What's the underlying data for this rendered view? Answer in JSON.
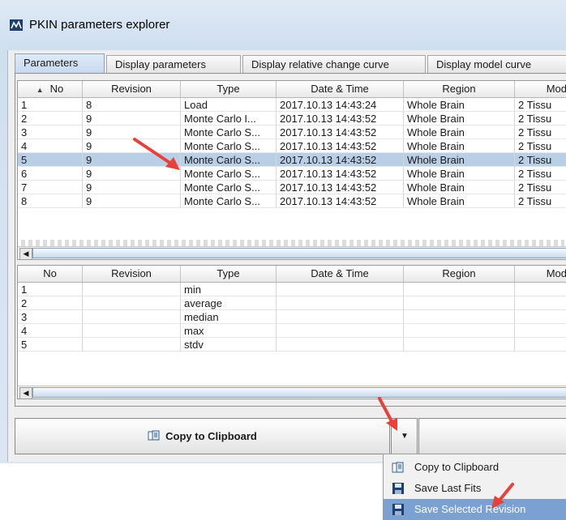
{
  "window": {
    "title": "PKIN parameters explorer"
  },
  "tabs": [
    {
      "label": "Parameters",
      "active": true
    },
    {
      "label": "Display parameters",
      "active": false
    },
    {
      "label": "Display relative change curve",
      "active": false
    },
    {
      "label": "Display model curve",
      "active": false
    }
  ],
  "top_table": {
    "sort_icon": "sort-ascending-triangle",
    "columns": [
      "No",
      "Revision",
      "Type",
      "Date & Time",
      "Region",
      "Mod"
    ],
    "rows": [
      {
        "no": "1",
        "revision": "8",
        "type": "Load",
        "datetime": "2017.10.13 14:43:24",
        "region": "Whole Brain",
        "model": "2 Tissu"
      },
      {
        "no": "2",
        "revision": "9",
        "type": "Monte Carlo I...",
        "datetime": "2017.10.13 14:43:52",
        "region": "Whole Brain",
        "model": "2 Tissu"
      },
      {
        "no": "3",
        "revision": "9",
        "type": "Monte Carlo S...",
        "datetime": "2017.10.13 14:43:52",
        "region": "Whole Brain",
        "model": "2 Tissu"
      },
      {
        "no": "4",
        "revision": "9",
        "type": "Monte Carlo S...",
        "datetime": "2017.10.13 14:43:52",
        "region": "Whole Brain",
        "model": "2 Tissu"
      },
      {
        "no": "5",
        "revision": "9",
        "type": "Monte Carlo S...",
        "datetime": "2017.10.13 14:43:52",
        "region": "Whole Brain",
        "model": "2 Tissu",
        "selected": true
      },
      {
        "no": "6",
        "revision": "9",
        "type": "Monte Carlo S...",
        "datetime": "2017.10.13 14:43:52",
        "region": "Whole Brain",
        "model": "2 Tissu"
      },
      {
        "no": "7",
        "revision": "9",
        "type": "Monte Carlo S...",
        "datetime": "2017.10.13 14:43:52",
        "region": "Whole Brain",
        "model": "2 Tissu"
      },
      {
        "no": "8",
        "revision": "9",
        "type": "Monte Carlo S...",
        "datetime": "2017.10.13 14:43:52",
        "region": "Whole Brain",
        "model": "2 Tissu"
      }
    ]
  },
  "bottom_table": {
    "columns": [
      "No",
      "Revision",
      "Type",
      "Date & Time",
      "Region",
      "Mod"
    ],
    "rows": [
      {
        "no": "1",
        "type": "min"
      },
      {
        "no": "2",
        "type": "average"
      },
      {
        "no": "3",
        "type": "median"
      },
      {
        "no": "4",
        "type": "max"
      },
      {
        "no": "5",
        "type": "stdv"
      }
    ]
  },
  "buttons": {
    "copy_label": "Copy to Clipboard"
  },
  "dropdown_menu": {
    "items": [
      {
        "label": "Copy to Clipboard",
        "icon": "clipboard-icon"
      },
      {
        "label": "Save Last Fits",
        "icon": "floppy-disk-icon"
      },
      {
        "label": "Save Selected Revision",
        "icon": "floppy-disk-icon",
        "highlighted": true
      }
    ]
  },
  "colors": {
    "selection": "#b8cfe6",
    "menu_highlight": "#7aa1d1",
    "annotation_arrow": "#e8413a"
  }
}
